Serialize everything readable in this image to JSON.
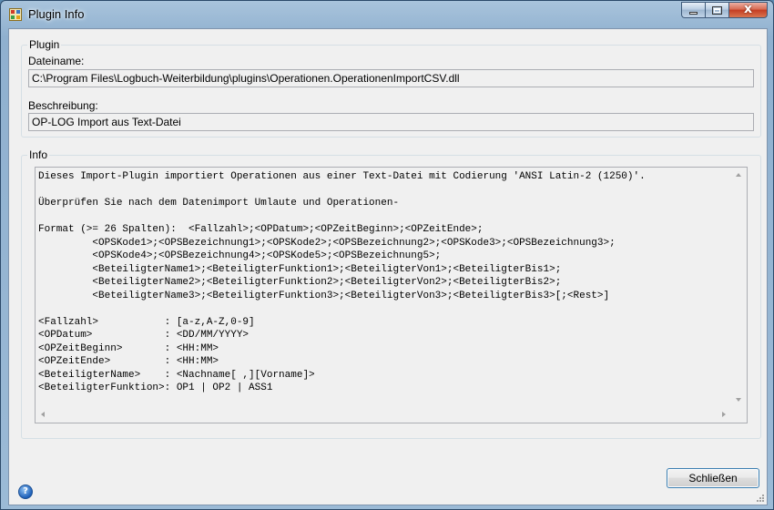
{
  "window": {
    "title": "Plugin Info",
    "icons": {
      "app": "plugin-app-icon",
      "minimize": "minimize-icon",
      "maximize": "maximize-icon",
      "close": "close-icon",
      "help": "help-icon"
    },
    "close_glyph": "x"
  },
  "plugin_group": {
    "title": "Plugin",
    "filename_label": "Dateiname:",
    "filename_value": "C:\\Program Files\\Logbuch-Weiterbildung\\plugins\\Operationen.OperationenImportCSV.dll",
    "description_label": "Beschreibung:",
    "description_value": "OP-LOG Import aus Text-Datei"
  },
  "info_group": {
    "title": "Info",
    "text": "Dieses Import-Plugin importiert Operationen aus einer Text-Datei mit Codierung 'ANSI Latin-2 (1250)'.\n\nÜberprüfen Sie nach dem Datenimport Umlaute und Operationen-\n\nFormat (>= 26 Spalten):  <Fallzahl>;<OPDatum>;<OPZeitBeginn>;<OPZeitEnde>;\n         <OPSKode1>;<OPSBezeichnung1>;<OPSKode2>;<OPSBezeichnung2>;<OPSKode3>;<OPSBezeichnung3>;\n         <OPSKode4>;<OPSBezeichnung4>;<OPSKode5>;<OPSBezeichnung5>;\n         <BeteiligterName1>;<BeteiligterFunktion1>;<BeteiligterVon1>;<BeteiligterBis1>;\n         <BeteiligterName2>;<BeteiligterFunktion2>;<BeteiligterVon2>;<BeteiligterBis2>;\n         <BeteiligterName3>;<BeteiligterFunktion3>;<BeteiligterVon3>;<BeteiligterBis3>[;<Rest>]\n\n<Fallzahl>           : [a-z,A-Z,0-9]\n<OPDatum>            : <DD/MM/YYYY>\n<OPZeitBeginn>       : <HH:MM>\n<OPZeitEnde>         : <HH:MM>\n<BeteiligterName>    : <Nachname[ ,][Vorname]>\n<BeteiligterFunktion>: OP1 | OP2 | ASS1"
  },
  "buttons": {
    "close_label": "Schließen"
  },
  "help": {
    "glyph": "?"
  }
}
